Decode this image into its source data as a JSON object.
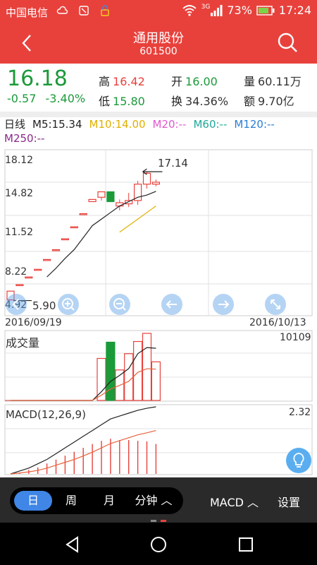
{
  "status": {
    "carrier": "中国电信",
    "battery": "73%",
    "time": "17:24",
    "network": "3G"
  },
  "header": {
    "stock_name": "通用股份",
    "stock_code": "601500"
  },
  "quote": {
    "price": "16.18",
    "change": "-0.57",
    "change_pct": "-3.40%",
    "high_label": "高",
    "high": "16.42",
    "low_label": "低",
    "low": "15.80",
    "open_label": "开",
    "open": "16.00",
    "turnover_label": "换",
    "turnover": "34.36%",
    "volume_label": "量",
    "volume": "60.11万",
    "amount_label": "额",
    "amount": "9.70亿"
  },
  "ma_legend": {
    "period": "日线",
    "m5": "M5:15.34",
    "m10": "M10:14.00",
    "m20": "M20:--",
    "m60": "M60:--",
    "m120": "M120:--",
    "m250": "M250:--"
  },
  "colors": {
    "brand": "#e8413c",
    "up": "#e8413c",
    "down": "#1b9a3a",
    "m5": "#222222",
    "m10": "#e0b000",
    "m20": "#e05ad0",
    "m60": "#21a89a",
    "m120": "#2a7ed6",
    "m250": "#8a2a8a",
    "tab_active": "#3f86e6"
  },
  "kline": {
    "y_ticks": [
      "18.12",
      "14.82",
      "11.52",
      "8.22",
      "4.92"
    ],
    "max_label": "17.14",
    "min_label": "5.90",
    "start_date": "2016/09/19",
    "end_date": "2016/10/13"
  },
  "volume": {
    "title": "成交量",
    "max_label": "10109"
  },
  "macd": {
    "title": "MACD(12,26,9)",
    "max_label": "2.32"
  },
  "chart_data": {
    "type": "candlestick",
    "ylim": [
      4.92,
      18.12
    ],
    "candles": [
      {
        "o": 5.4,
        "h": 6.2,
        "l": 5.4,
        "c": 6.2
      },
      {
        "o": 6.8,
        "h": 6.8,
        "l": 6.8,
        "c": 6.8
      },
      {
        "o": 7.5,
        "h": 7.5,
        "l": 7.5,
        "c": 7.5
      },
      {
        "o": 8.2,
        "h": 8.2,
        "l": 8.2,
        "c": 8.2
      },
      {
        "o": 9.1,
        "h": 9.1,
        "l": 9.1,
        "c": 9.1
      },
      {
        "o": 10.0,
        "h": 10.0,
        "l": 10.0,
        "c": 10.0
      },
      {
        "o": 11.0,
        "h": 11.0,
        "l": 11.0,
        "c": 11.0
      },
      {
        "o": 12.1,
        "h": 12.1,
        "l": 12.1,
        "c": 12.1
      },
      {
        "o": 13.3,
        "h": 13.3,
        "l": 13.3,
        "c": 13.3
      },
      {
        "o": 14.4,
        "h": 14.6,
        "l": 14.4,
        "c": 14.6
      },
      {
        "o": 14.8,
        "h": 15.3,
        "l": 14.5,
        "c": 15.3
      },
      {
        "o": 15.3,
        "h": 15.3,
        "l": 14.4,
        "c": 14.4
      },
      {
        "o": 14.0,
        "h": 14.6,
        "l": 13.6,
        "c": 14.3
      },
      {
        "o": 14.2,
        "h": 15.2,
        "l": 13.9,
        "c": 14.5
      },
      {
        "o": 14.5,
        "h": 16.3,
        "l": 14.1,
        "c": 16.0
      },
      {
        "o": 16.0,
        "h": 17.14,
        "l": 15.6,
        "c": 17.0
      },
      {
        "o": 16.0,
        "h": 16.42,
        "l": 15.8,
        "c": 16.18
      }
    ],
    "ma5": [
      null,
      null,
      null,
      null,
      7.5,
      8.3,
      9.2,
      10.0,
      11.1,
      12.2,
      12.8,
      13.4,
      14.0,
      14.4,
      14.8,
      15.0,
      15.34
    ],
    "ma10": [
      null,
      null,
      null,
      null,
      null,
      null,
      null,
      null,
      null,
      null,
      null,
      null,
      11.6,
      12.2,
      12.8,
      13.4,
      14.0
    ],
    "volume_ylim": [
      0,
      10109
    ],
    "volumes": [
      0,
      0,
      0,
      0,
      0,
      0,
      0,
      0,
      0,
      0,
      6200,
      8600,
      4500,
      6900,
      8700,
      9900,
      5700
    ],
    "volume_ma": [
      0,
      0,
      0,
      0,
      0,
      0,
      0,
      0,
      0,
      0,
      1300,
      2800,
      3700,
      4700,
      6900,
      7800,
      7700
    ],
    "macd_ylim": [
      0,
      2.32
    ],
    "macd_bars": [
      0,
      0.05,
      0.15,
      0.25,
      0.4,
      0.55,
      0.7,
      0.85,
      1.0,
      1.15,
      1.27,
      1.35,
      1.3,
      1.3,
      1.27,
      1.25,
      1.15
    ],
    "dif": [
      0,
      0.1,
      0.2,
      0.35,
      0.5,
      0.7,
      0.9,
      1.1,
      1.3,
      1.5,
      1.7,
      1.9,
      2.0,
      2.1,
      2.2,
      2.27,
      2.32
    ],
    "dea": [
      0,
      0.03,
      0.07,
      0.12,
      0.2,
      0.3,
      0.4,
      0.5,
      0.62,
      0.75,
      0.9,
      1.05,
      1.15,
      1.25,
      1.35,
      1.42,
      1.5
    ]
  },
  "tabs": {
    "day": "日",
    "week": "周",
    "month": "月",
    "minute": "分钟 ︿",
    "indicator": "MACD ︿",
    "settings": "设置"
  }
}
